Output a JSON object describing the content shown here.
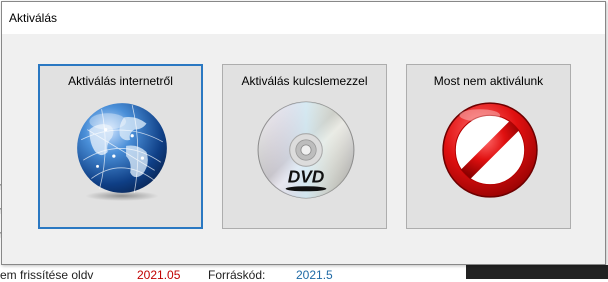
{
  "background_app": {
    "status_label": "em frissítése oldv",
    "status_value": "2021.05",
    "source_label": "Forráskód:",
    "source_value": "2021.5"
  },
  "dialog": {
    "title": "Aktiválás",
    "choices": [
      {
        "label": "Aktiválás internetről",
        "icon": "globe-icon",
        "focused": true
      },
      {
        "label": "Aktiválás kulcslemezzel",
        "icon": "dvd-disc-icon",
        "focused": false
      },
      {
        "label": "Most nem aktiválunk",
        "icon": "no-entry-icon",
        "focused": false
      }
    ]
  },
  "colors": {
    "focus_border": "#2a78c2",
    "button_face": "#e1e1e1",
    "dialog_bg": "#f0f0f0",
    "red_value": "#c00000",
    "blue_value": "#1f6aa5"
  }
}
